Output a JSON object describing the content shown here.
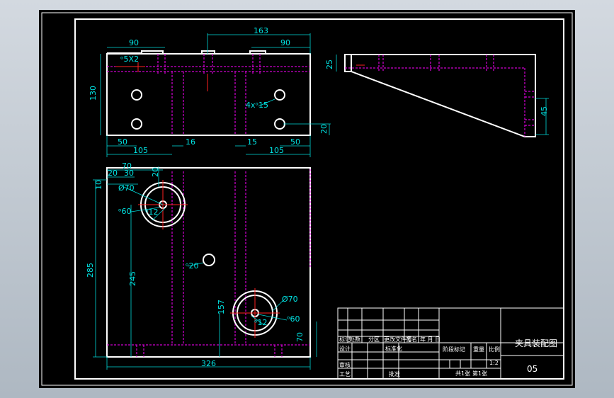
{
  "drawing": {
    "title": "夹具装配图",
    "number": "05",
    "scale": "1:2",
    "colors": {
      "background": "#000000",
      "outline": "#ffffff",
      "dimension": "#00e5e5",
      "hidden": "#ff00ff",
      "center": "#ff2020"
    }
  },
  "top_view": {
    "dims": {
      "d163": "163",
      "d90_left": "90",
      "d90_right": "90",
      "d130": "130",
      "hole_spec_left": "ᵒ5X2",
      "hole_spec_right": "4xᵒ15",
      "d50_left": "50",
      "d105_left": "105",
      "d16": "16",
      "d15": "15",
      "d105_right": "105",
      "d50_right": "50",
      "d20": "20"
    }
  },
  "side_view": {
    "dims": {
      "d25": "25",
      "d45": "45"
    }
  },
  "front_view": {
    "dims": {
      "d70_top": "70",
      "d20_a": "20",
      "d30": "30",
      "d20_b": "20",
      "d10": "10",
      "phi70_top": "Ø70",
      "phi60_top": "ᵒ60",
      "phi12_top": "ᵒ12",
      "d285": "285",
      "phi20": "ᵒ20",
      "d245": "245",
      "d157": "157",
      "phi70_bottom": "Ø70",
      "phi60_bottom": "ᵒ60",
      "phi12_bottom": "ᵒ12",
      "d70_right": "70",
      "d326": "326"
    }
  },
  "title_block": {
    "row_labels": [
      "标记",
      "处数",
      "分区",
      "更改文件号",
      "签名",
      "年 月 日"
    ],
    "design": "设计",
    "standardization": "标准化",
    "review": "审核",
    "process": "工艺",
    "approve": "批准",
    "stage_mark": "阶段标记",
    "weight": "重量",
    "ratio": "比例",
    "sheets": "共1张",
    "sheet_no": "第1张"
  }
}
